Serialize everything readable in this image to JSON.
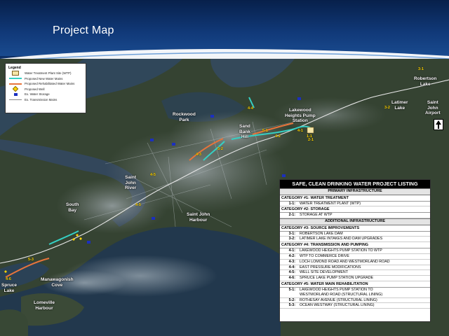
{
  "slide": {
    "title": "Project Map"
  },
  "legend": {
    "title": "Legend",
    "items": [
      {
        "label": "Water Treatment Plant Site (WTP)",
        "symbol": "wtp-site-symbol",
        "color": "#f5e6a8"
      },
      {
        "label": "Proposed New Water Mains",
        "symbol": "new-main-line",
        "color": "#35d0c4"
      },
      {
        "label": "Proposed Rehabilitated Water Mains",
        "symbol": "rehab-main-line",
        "color": "#e8743b"
      },
      {
        "label": "Proposed Well",
        "symbol": "well-diamond",
        "color": "#ffd400"
      },
      {
        "label": "Ex. Water Storage",
        "symbol": "storage-square",
        "color": "#1b2fbf"
      },
      {
        "label": "Ex. Transmission Mains",
        "symbol": "transmission-line",
        "color": "#d0d0d0"
      }
    ]
  },
  "map_labels": [
    {
      "key": "rockwood",
      "text": "Rockwood\nPark"
    },
    {
      "key": "lakewood",
      "text": "Lakewood\nHeights Pump\nStation"
    },
    {
      "key": "sandbank",
      "text": "Sand\nBank\nHill"
    },
    {
      "key": "robertson",
      "text": "Robertson\nLake"
    },
    {
      "key": "latimer",
      "text": "Latimer\nLake"
    },
    {
      "key": "airport",
      "text": "Saint\nJohn\nAirport"
    },
    {
      "key": "sjriver",
      "text": "Saint\nJohn\nRiver"
    },
    {
      "key": "southbay",
      "text": "South\nBay"
    },
    {
      "key": "sjharbour",
      "text": "Saint John\nHarbour"
    },
    {
      "key": "manawagonish",
      "text": "Manawagonish\nCove"
    },
    {
      "key": "lomeville",
      "text": "Lomeville\nHarbour"
    },
    {
      "key": "spruce",
      "text": "Spruce\nLake"
    }
  ],
  "map_codes": [
    {
      "key": "c44",
      "text": "4-4"
    },
    {
      "key": "c51",
      "text": "5-1"
    },
    {
      "key": "c42",
      "text": "4-2"
    },
    {
      "key": "c11",
      "text": "1-1"
    },
    {
      "key": "c41",
      "text": "4-1"
    },
    {
      "key": "c43",
      "text": "4-3"
    },
    {
      "key": "c32",
      "text": "3-2"
    },
    {
      "key": "c31",
      "text": "3-1"
    },
    {
      "key": "c45",
      "text": "4-5"
    },
    {
      "key": "c45b",
      "text": "4-5"
    },
    {
      "key": "c46",
      "text": "4-6"
    },
    {
      "key": "c52",
      "text": "5-2"
    },
    {
      "key": "c53",
      "text": "5-3"
    },
    {
      "key": "c21",
      "text": "2-1"
    }
  ],
  "listing": {
    "title": "SAFE, CLEAN DRINKING WATER PROJECT LISTING",
    "sections": [
      {
        "heading": "PRIMARY INFRASTRUCTURE",
        "categories": [
          {
            "name": "CATEGORY #1: WATER TREATMENT",
            "items": [
              {
                "num": "1-1:",
                "name": "WATER TREATMENT PLANT (WTP)"
              }
            ]
          },
          {
            "name": "CATEGORY #2: STORAGE",
            "items": [
              {
                "num": "2-1:",
                "name": "STORAGE AT WTP"
              }
            ]
          }
        ]
      },
      {
        "heading": "ADDITIONAL INFRASTRUCTURE",
        "categories": [
          {
            "name": "CATEGORY #3: SOURCE IMPROVEMENTS",
            "items": [
              {
                "num": "3-1:",
                "name": "ROBERTSON LAKE DAM"
              },
              {
                "num": "3-2:",
                "name": "LATIMER LAKE INTAKES AND DAM UPGRADES"
              }
            ]
          },
          {
            "name": "CATEGORY #4: TRANSMISSION AND PUMPING",
            "items": [
              {
                "num": "4-1:",
                "name": "LAKEWOOD HEIGHTS PUMP STATION TO WTP"
              },
              {
                "num": "4-2:",
                "name": "WTP TO COMMERCE DRIVE"
              },
              {
                "num": "4-3:",
                "name": "LOCH LOMOND ROAD AND WESTMORLAND ROAD"
              },
              {
                "num": "4-4:",
                "name": "EAST PRESSURE MODIFICATIONS"
              },
              {
                "num": "4-5:",
                "name": "WELL SITE DEVELOPMENT"
              },
              {
                "num": "4-6:",
                "name": "SPRUCE LAKE PUMP STATION UPGRADE"
              }
            ]
          },
          {
            "name": "CATEGORY #5: WATER MAIN REHABILITATION",
            "items": [
              {
                "num": "5-1:",
                "name": "LAKEWOOD HEIGHTS PUMP STATION TO\nWESTMORLAND ROAD (STRUCTURAL LINING)"
              },
              {
                "num": "5-2:",
                "name": "ROTHESAY AVENUE (STRUCTURAL LINING)"
              },
              {
                "num": "5-3:",
                "name": "OCEAN WESTWAY (STRUCTURAL LINING)"
              }
            ]
          }
        ]
      }
    ]
  }
}
